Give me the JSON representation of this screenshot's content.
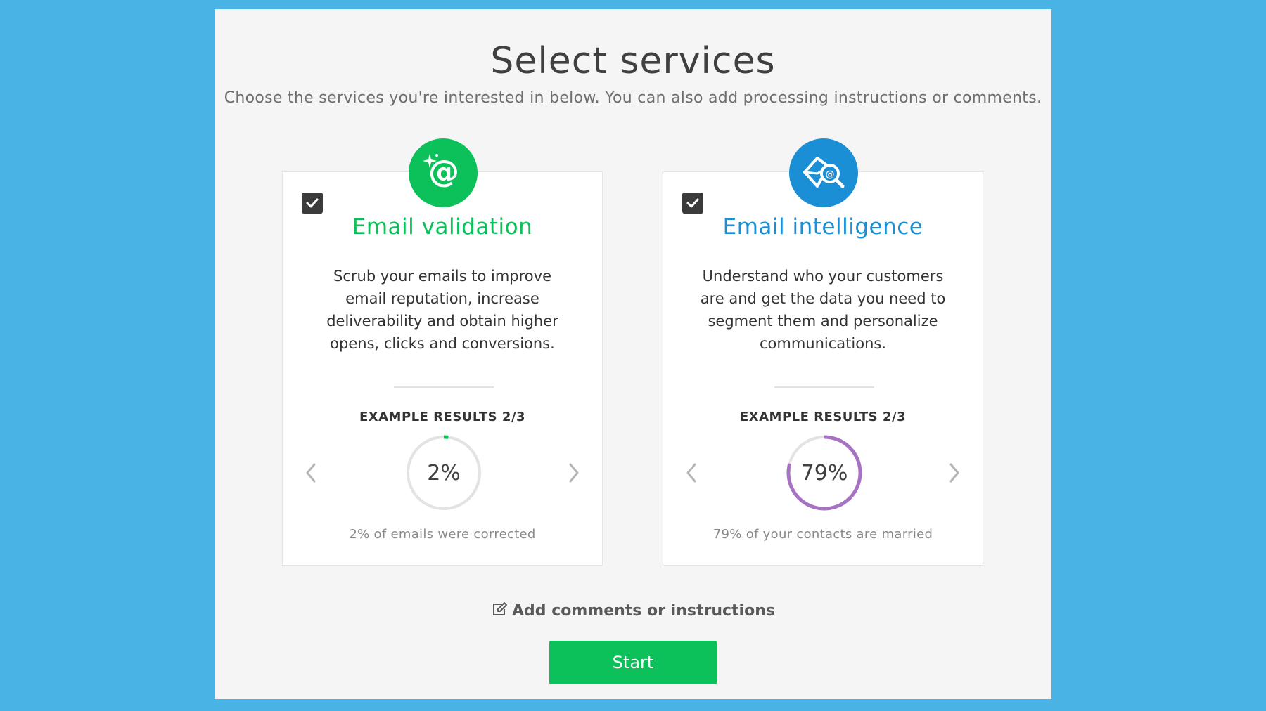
{
  "header": {
    "title": "Select services",
    "subtitle": "Choose the services you're interested in below. You can also add processing instructions or comments."
  },
  "colors": {
    "page_background": "#4ab3e6",
    "validation_accent": "#0dc15a",
    "intelligence_accent": "#1a8fd6",
    "gauge_intelligence": "#a872c4",
    "gauge_track": "#e3e3e3"
  },
  "services": [
    {
      "title": "Email validation",
      "icon": "sparkle-at-icon",
      "checked": true,
      "description": "Scrub your emails to improve email reputation, increase deliverability and obtain higher opens, clicks and conversions.",
      "results_label": "EXAMPLE RESULTS 2/3",
      "gauge_percent": 2,
      "gauge_text": "2%",
      "caption": "2% of emails were corrected"
    },
    {
      "title": "Email intelligence",
      "icon": "envelope-search-icon",
      "checked": true,
      "description": "Understand who your customers are and get the data you need to segment them and personalize communications.",
      "results_label": "EXAMPLE RESULTS 2/3",
      "gauge_percent": 79,
      "gauge_text": "79%",
      "caption": "79% of your contacts are married"
    }
  ],
  "footer": {
    "comments_label": "Add comments or instructions",
    "start_label": "Start"
  }
}
